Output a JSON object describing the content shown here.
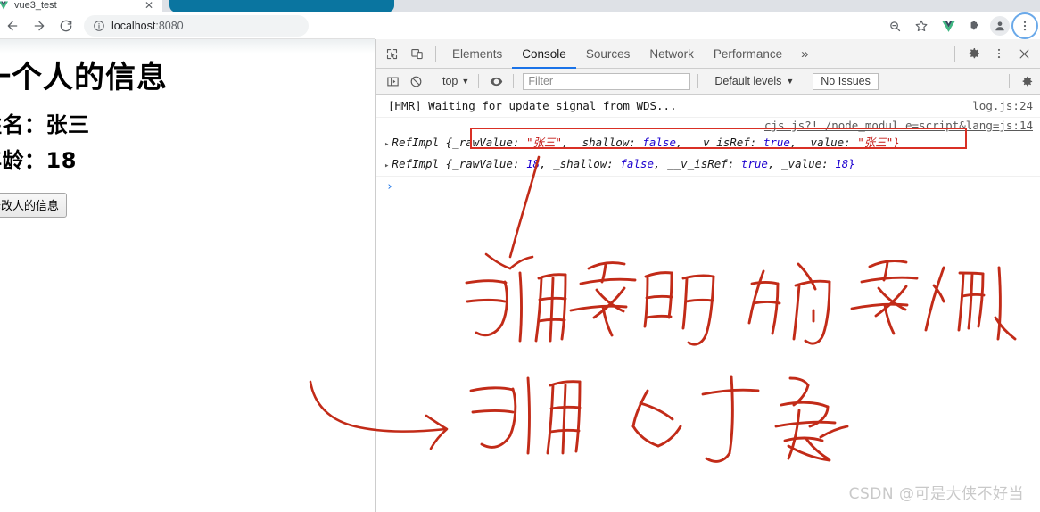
{
  "browser": {
    "tab": {
      "title": "vue3_test",
      "favicon_icon": "vue-favicon-icon",
      "close_icon": "close-icon"
    },
    "new_tab_button": {
      "icon": "plus-icon",
      "label": "+"
    },
    "nav": {
      "back_icon": "arrow-back-icon",
      "forward_icon": "arrow-forward-icon",
      "reload_icon": "reload-icon"
    },
    "omnibox": {
      "info_icon": "info-circle-icon",
      "host": "localhost",
      "port": ":8080",
      "value": "localhost:8080"
    },
    "toolbar_right": [
      {
        "name": "zoom-search-icon",
        "label": ""
      },
      {
        "name": "bookmark-star-icon",
        "label": ""
      },
      {
        "name": "vue-devtools-icon",
        "label": ""
      },
      {
        "name": "extensions-puzzle-icon",
        "label": ""
      },
      {
        "name": "profile-avatar-icon",
        "label": ""
      },
      {
        "name": "chrome-menu-icon",
        "label": ""
      }
    ]
  },
  "page": {
    "heading": "一个人的信息",
    "rows": [
      {
        "label": "姓名：",
        "value": "张三"
      },
      {
        "label": "年龄：",
        "value": "18"
      }
    ],
    "button_label": "修改人的信息"
  },
  "devtools": {
    "inspect_icon": "inspect-element-icon",
    "device_toolbar_icon": "device-toolbar-icon",
    "tabs": [
      {
        "label": "Elements",
        "active": false
      },
      {
        "label": "Console",
        "active": true
      },
      {
        "label": "Sources",
        "active": false
      },
      {
        "label": "Network",
        "active": false
      },
      {
        "label": "Performance",
        "active": false
      }
    ],
    "overflow_label": "»",
    "settings_icon": "gear-icon",
    "more_icon": "kebab-menu-icon",
    "close_icon": "close-icon",
    "filterbar": {
      "sidebar_icon": "console-sidebar-icon",
      "clear_icon": "clear-console-icon",
      "context_label": "top",
      "context_caret": "▼",
      "eye_icon": "live-expression-eye-icon",
      "filter_placeholder": "Filter",
      "filter_value": "",
      "levels_label": "Default levels",
      "levels_caret": "▼",
      "issues_label": "No Issues",
      "settings_icon": "gear-icon"
    },
    "console": {
      "messages": [
        {
          "kind": "log",
          "text": "[HMR] Waiting for update signal from WDS...",
          "source": "log.js:24"
        }
      ],
      "object_group": {
        "source": "cjs.js?!./node_modul…e=script&lang=js:14",
        "entries": [
          {
            "triangle": "▸",
            "class_name": "RefImpl",
            "props": [
              {
                "key": "{_rawValue:",
                "value": "\"张三\"",
                "type": "string"
              },
              {
                "key": "_shallow:",
                "value": "false",
                "type": "bool"
              },
              {
                "key": "__v_isRef:",
                "value": "true",
                "type": "bool"
              },
              {
                "key": "_value:",
                "value": "\"张三\"}",
                "type": "string"
              }
            ],
            "highlighted": true
          },
          {
            "triangle": "▸",
            "class_name": "RefImpl",
            "props": [
              {
                "key": "{_rawValue:",
                "value": "18",
                "type": "number"
              },
              {
                "key": "_shallow:",
                "value": "false",
                "type": "bool"
              },
              {
                "key": "__v_isRef:",
                "value": "true",
                "type": "bool"
              },
              {
                "key": "_value:",
                "value": "18}",
                "type": "number"
              }
            ],
            "highlighted": false
          }
        ]
      },
      "prompt_symbol": "›"
    }
  },
  "annotations": {
    "ink_color": "#c22b18",
    "highlight_box_color": "#d93025",
    "handwriting": [
      {
        "text": "引用实现 的实例",
        "note": "points to first RefImpl line"
      },
      {
        "text": "引用对象",
        "note": "points from left with long arrow"
      }
    ]
  },
  "watermark": {
    "text": "CSDN @可是大侠不好当",
    "color": "#c9c9c9"
  }
}
